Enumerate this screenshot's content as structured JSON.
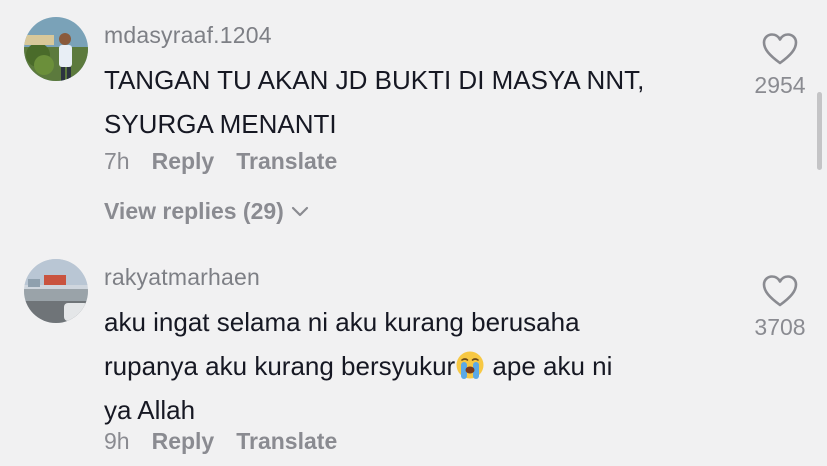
{
  "comments": [
    {
      "username": "mdasyraaf.1204",
      "text_lines": [
        "TANGAN TU AKAN JD BUKTI DI MASYA NNT,",
        "SYURGA MENANTI"
      ],
      "time": "7h",
      "reply_label": "Reply",
      "translate_label": "Translate",
      "likes": "2954",
      "view_replies": "View replies (29)"
    },
    {
      "username": "rakyatmarhaen",
      "text_line1": "aku ingat selama ni aku kurang berusaha",
      "text_line2_before": "rupanya aku kurang bersyukur",
      "text_line2_after": " ape aku ni",
      "text_line3": "ya Allah",
      "time": "9h",
      "reply_label": "Reply",
      "translate_label": "Translate",
      "likes": "3708"
    }
  ],
  "icons": {
    "like": "heart-outline-icon",
    "chevron": "chevron-down-icon",
    "emoji": "loudly-crying-face-emoji"
  },
  "colors": {
    "background": "#f1f1f2",
    "primary_text": "#161823",
    "secondary_text": "#8a8b91"
  }
}
